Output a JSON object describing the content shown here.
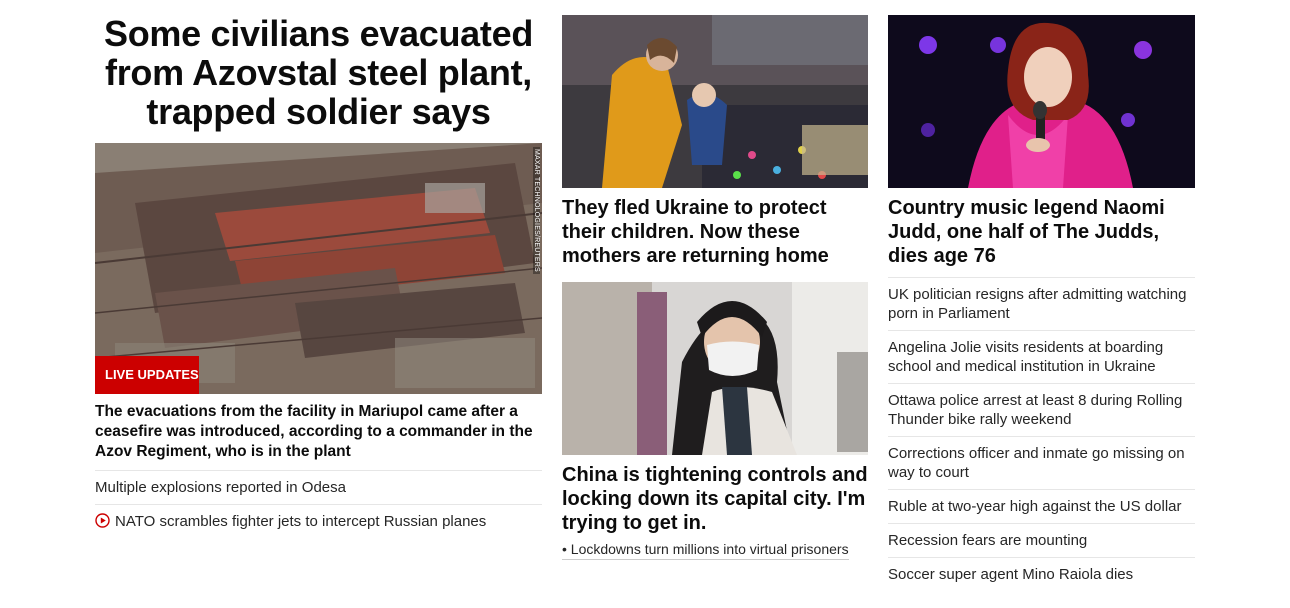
{
  "lead": {
    "headline": "Some civilians evacuated from Azovstal steel plant, trapped soldier says",
    "image_credit": "MAXAR TECHNOLOGIES/REUTERS",
    "badge": "LIVE UPDATES",
    "summary": "The evacuations from the facility in Mariupol came after a ceasefire was introduced, according to a commander in the Azov Regiment, who is in the plant",
    "links": [
      {
        "text": "Multiple explosions reported in Odesa"
      },
      {
        "text": "NATO scrambles fighter jets to intercept Russian planes",
        "icon": "play-icon"
      }
    ]
  },
  "middle": {
    "story1": {
      "title": "They fled Ukraine to protect their children. Now these mothers are returning home"
    },
    "story2": {
      "title": "China is tightening controls and locking down its capital city. I'm trying to get in.",
      "sublink": "• Lockdowns turn millions into virtual prisoners"
    }
  },
  "right": {
    "story": {
      "title": "Country music legend Naomi Judd, one half of The Judds, dies age 76"
    },
    "links": [
      "UK politician resigns after admitting watching porn in Parliament",
      "Angelina Jolie visits residents at boarding school and medical institution in Ukraine",
      "Ottawa police arrest at least 8 during Rolling Thunder bike rally weekend",
      "Corrections officer and inmate go missing on way to court",
      "Ruble at two-year high against the US dollar",
      "Recession fears are mounting",
      "Soccer super agent Mino Raiola dies"
    ]
  },
  "colors": {
    "badge_red": "#cc0000",
    "headline": "#0c0c0c",
    "text": "#262626",
    "divider": "#e6e6e6"
  }
}
